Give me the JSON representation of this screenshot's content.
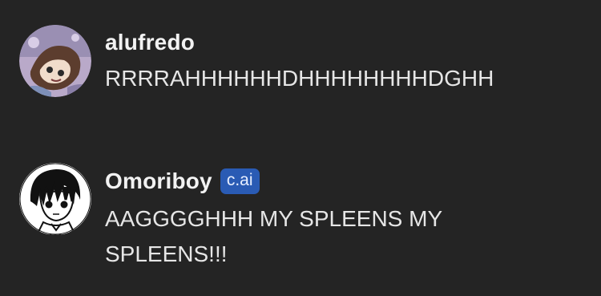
{
  "messages": [
    {
      "author": "alufredo",
      "avatar_icon": "anime-character-avatar-icon",
      "text": "RRRRAHHHHHHDHHHHHHHHDGHH"
    },
    {
      "author": "Omoriboy",
      "badge": "c.ai",
      "badge_color": "#2a5bb4",
      "avatar_icon": "omori-character-avatar-icon",
      "text": "AAGGGGHHH MY SPLEENS MY SPLEENS!!!"
    }
  ],
  "colors": {
    "background": "#242424",
    "text": "#e6e6e6"
  }
}
